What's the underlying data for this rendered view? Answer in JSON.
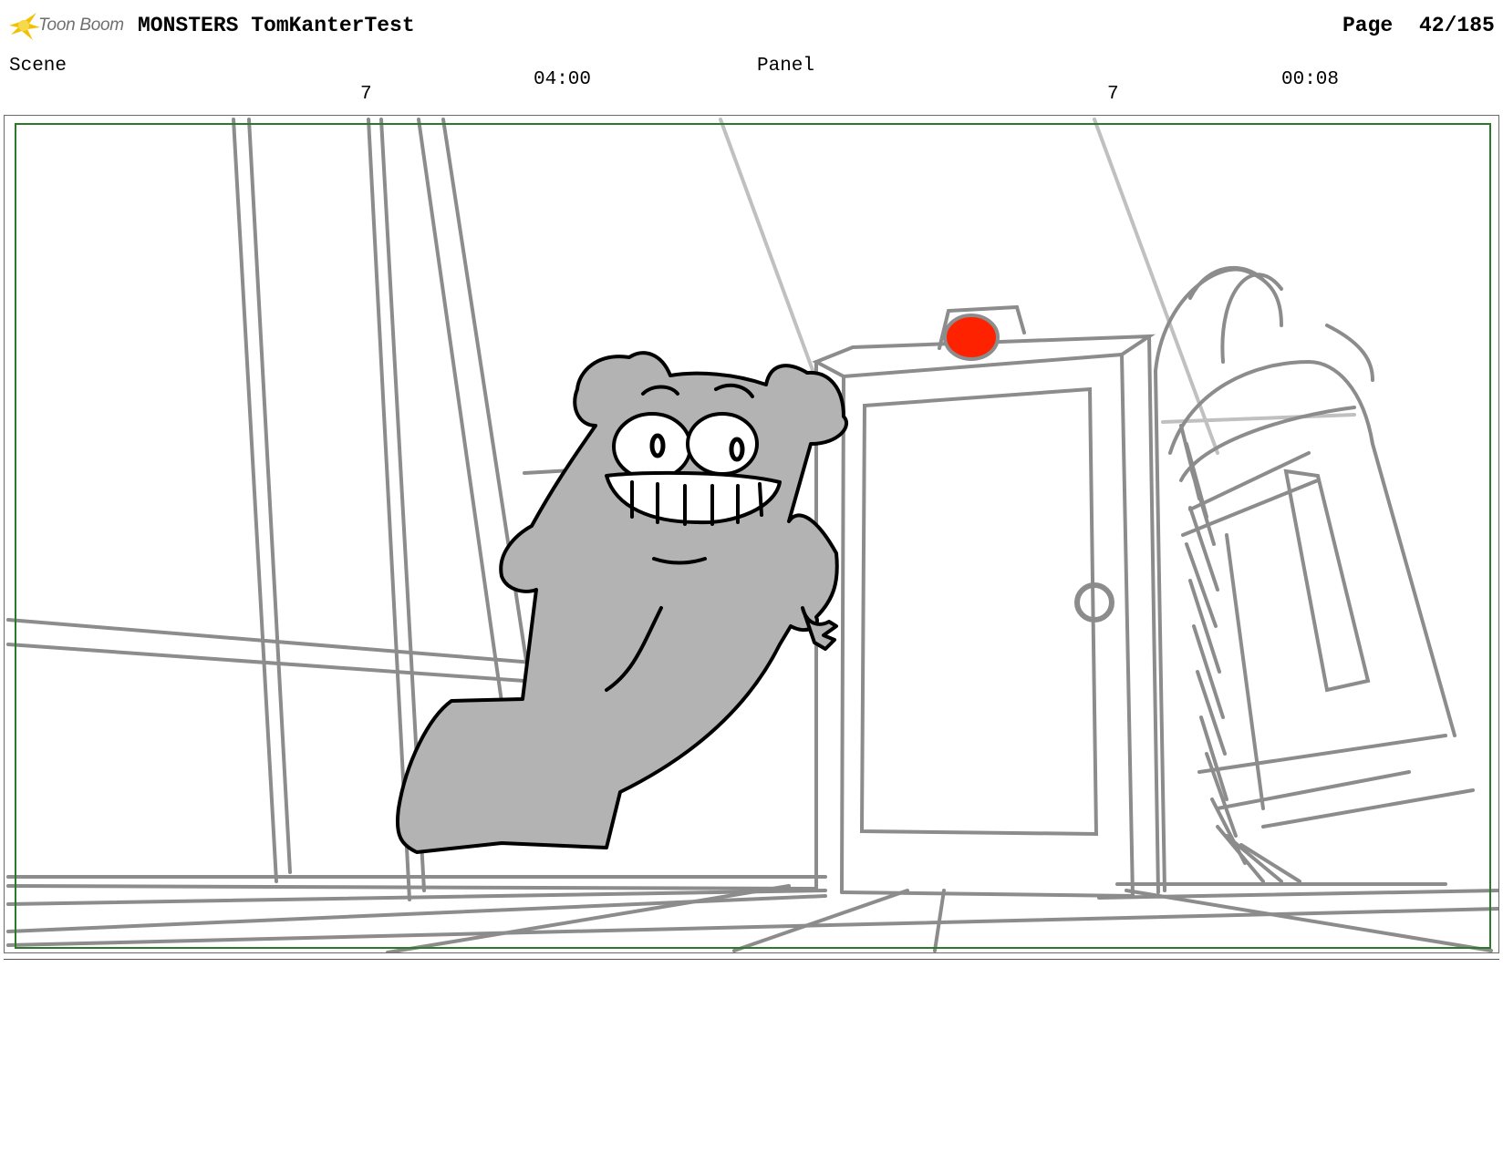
{
  "header": {
    "logo_text": "Toon Boom",
    "project_title": "MONSTERS TomKanterTest",
    "page_label": "Page",
    "page_number": "42/185"
  },
  "scene": {
    "label": "Scene",
    "number": "7",
    "duration": "04:00"
  },
  "panel": {
    "label": "Panel",
    "number": "7",
    "duration": "00:08"
  },
  "colors": {
    "safe_area_border": "#2a7a2a",
    "monster_fill": "#b3b3b3",
    "alarm_light": "#ff2200",
    "sketch_lines": "#8c8c8c",
    "logo_accent": "#f2c200"
  }
}
